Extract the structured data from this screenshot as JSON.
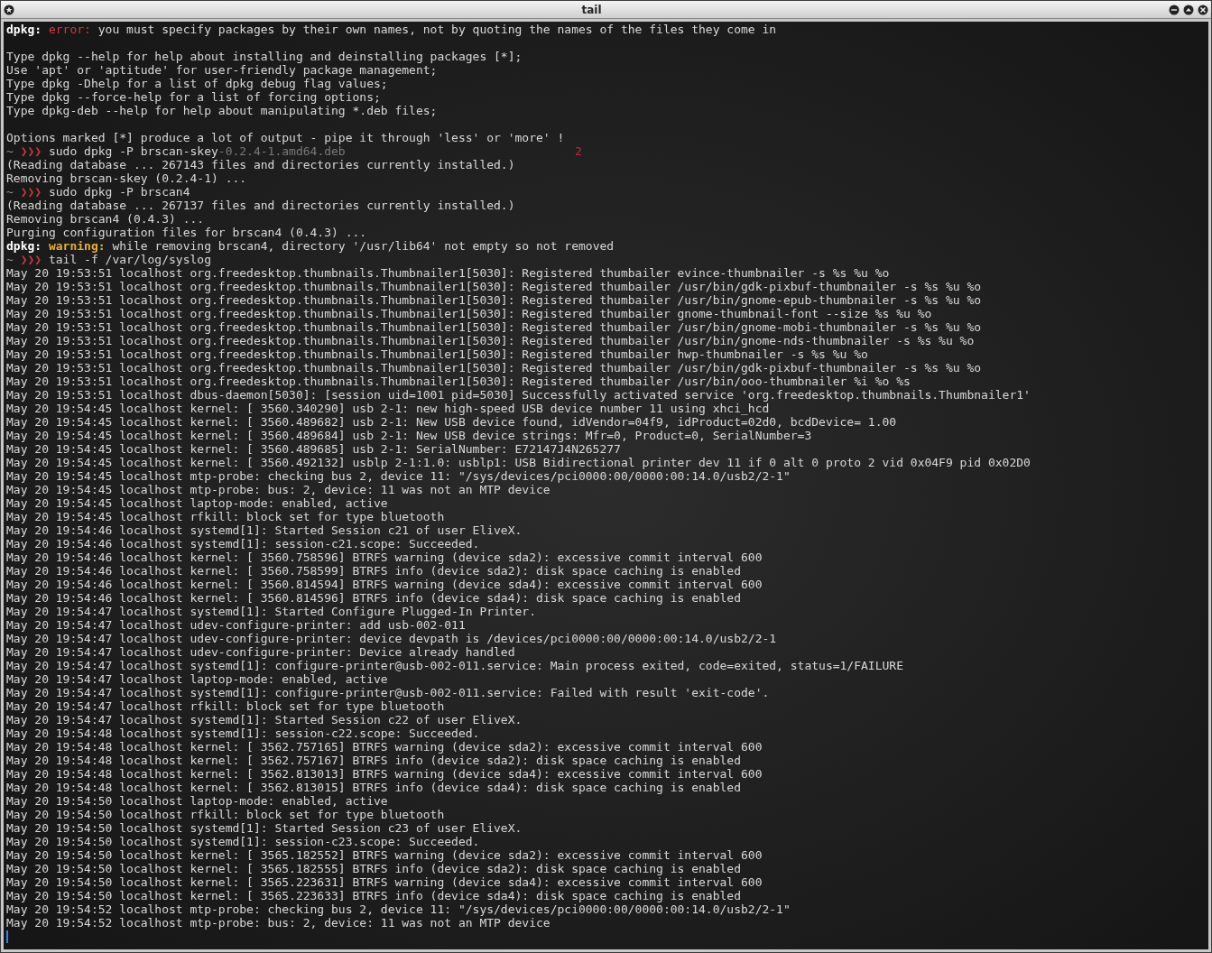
{
  "window": {
    "title": "tail"
  },
  "lines": [
    {
      "kind": "text",
      "segments": [
        {
          "kind": "bold",
          "text": "dpkg:"
        },
        {
          "kind": "error",
          "text": " error:"
        },
        {
          "kind": "plain",
          "text": " you must specify packages by their own names, not by quoting the names of the files they come in"
        }
      ]
    },
    {
      "kind": "blank"
    },
    {
      "kind": "text",
      "segments": [
        {
          "kind": "plain",
          "text": "Type dpkg --help for help about installing and deinstalling packages [*];"
        }
      ]
    },
    {
      "kind": "text",
      "segments": [
        {
          "kind": "plain",
          "text": "Use 'apt' or 'aptitude' for user-friendly package management;"
        }
      ]
    },
    {
      "kind": "text",
      "segments": [
        {
          "kind": "plain",
          "text": "Type dpkg -Dhelp for a list of dpkg debug flag values;"
        }
      ]
    },
    {
      "kind": "text",
      "segments": [
        {
          "kind": "plain",
          "text": "Type dpkg --force-help for a list of forcing options;"
        }
      ]
    },
    {
      "kind": "text",
      "segments": [
        {
          "kind": "plain",
          "text": "Type dpkg-deb --help for help about manipulating *.deb files;"
        }
      ]
    },
    {
      "kind": "blank"
    },
    {
      "kind": "text",
      "segments": [
        {
          "kind": "plain",
          "text": "Options marked [*] produce a lot of output - pipe it through 'less' or 'more' !"
        }
      ]
    },
    {
      "kind": "text",
      "segments": [
        {
          "kind": "tilde",
          "text": "~"
        },
        {
          "kind": "prompt",
          "text": "❯❯❯"
        },
        {
          "kind": "plain",
          "text": " sudo dpkg -P brscan-skey"
        },
        {
          "kind": "dim",
          "text": "-0.2.4-1.amd64.deb"
        },
        {
          "kind": "status",
          "text": "2"
        }
      ]
    },
    {
      "kind": "text",
      "segments": [
        {
          "kind": "plain",
          "text": "(Reading database ... 267143 files and directories currently installed.)"
        }
      ]
    },
    {
      "kind": "text",
      "segments": [
        {
          "kind": "plain",
          "text": "Removing brscan-skey (0.2.4-1) ..."
        }
      ]
    },
    {
      "kind": "text",
      "segments": [
        {
          "kind": "tilde",
          "text": "~"
        },
        {
          "kind": "prompt",
          "text": "❯❯❯"
        },
        {
          "kind": "plain",
          "text": " sudo dpkg -P brscan4"
        }
      ]
    },
    {
      "kind": "text",
      "segments": [
        {
          "kind": "plain",
          "text": "(Reading database ... 267137 files and directories currently installed.)"
        }
      ]
    },
    {
      "kind": "text",
      "segments": [
        {
          "kind": "plain",
          "text": "Removing brscan4 (0.4.3) ..."
        }
      ]
    },
    {
      "kind": "text",
      "segments": [
        {
          "kind": "plain",
          "text": "Purging configuration files for brscan4 (0.4.3) ..."
        }
      ]
    },
    {
      "kind": "text",
      "segments": [
        {
          "kind": "bold",
          "text": "dpkg:"
        },
        {
          "kind": "warning",
          "text": " warning:"
        },
        {
          "kind": "plain",
          "text": " while removing brscan4, directory '/usr/lib64' not empty so not removed"
        }
      ]
    },
    {
      "kind": "text",
      "segments": [
        {
          "kind": "tilde",
          "text": "~"
        },
        {
          "kind": "prompt",
          "text": "❯❯❯"
        },
        {
          "kind": "plain",
          "text": " tail -f /var/log/syslog"
        }
      ]
    },
    {
      "kind": "text",
      "segments": [
        {
          "kind": "plain",
          "text": "May 20 19:53:51 localhost org.freedesktop.thumbnails.Thumbnailer1[5030]: Registered thumbailer evince-thumbnailer -s %s %u %o"
        }
      ]
    },
    {
      "kind": "text",
      "segments": [
        {
          "kind": "plain",
          "text": "May 20 19:53:51 localhost org.freedesktop.thumbnails.Thumbnailer1[5030]: Registered thumbailer /usr/bin/gdk-pixbuf-thumbnailer -s %s %u %o"
        }
      ]
    },
    {
      "kind": "text",
      "segments": [
        {
          "kind": "plain",
          "text": "May 20 19:53:51 localhost org.freedesktop.thumbnails.Thumbnailer1[5030]: Registered thumbailer /usr/bin/gnome-epub-thumbnailer -s %s %u %o"
        }
      ]
    },
    {
      "kind": "text",
      "segments": [
        {
          "kind": "plain",
          "text": "May 20 19:53:51 localhost org.freedesktop.thumbnails.Thumbnailer1[5030]: Registered thumbailer gnome-thumbnail-font --size %s %u %o"
        }
      ]
    },
    {
      "kind": "text",
      "segments": [
        {
          "kind": "plain",
          "text": "May 20 19:53:51 localhost org.freedesktop.thumbnails.Thumbnailer1[5030]: Registered thumbailer /usr/bin/gnome-mobi-thumbnailer -s %s %u %o"
        }
      ]
    },
    {
      "kind": "text",
      "segments": [
        {
          "kind": "plain",
          "text": "May 20 19:53:51 localhost org.freedesktop.thumbnails.Thumbnailer1[5030]: Registered thumbailer /usr/bin/gnome-nds-thumbnailer -s %s %u %o"
        }
      ]
    },
    {
      "kind": "text",
      "segments": [
        {
          "kind": "plain",
          "text": "May 20 19:53:51 localhost org.freedesktop.thumbnails.Thumbnailer1[5030]: Registered thumbailer hwp-thumbnailer -s %s %u %o"
        }
      ]
    },
    {
      "kind": "text",
      "segments": [
        {
          "kind": "plain",
          "text": "May 20 19:53:51 localhost org.freedesktop.thumbnails.Thumbnailer1[5030]: Registered thumbailer /usr/bin/gdk-pixbuf-thumbnailer -s %s %u %o"
        }
      ]
    },
    {
      "kind": "text",
      "segments": [
        {
          "kind": "plain",
          "text": "May 20 19:53:51 localhost org.freedesktop.thumbnails.Thumbnailer1[5030]: Registered thumbailer /usr/bin/ooo-thumbnailer %i %o %s"
        }
      ]
    },
    {
      "kind": "text",
      "segments": [
        {
          "kind": "plain",
          "text": "May 20 19:53:51 localhost dbus-daemon[5030]: [session uid=1001 pid=5030] Successfully activated service 'org.freedesktop.thumbnails.Thumbnailer1'"
        }
      ]
    },
    {
      "kind": "text",
      "segments": [
        {
          "kind": "plain",
          "text": "May 20 19:54:45 localhost kernel: [ 3560.340290] usb 2-1: new high-speed USB device number 11 using xhci_hcd"
        }
      ]
    },
    {
      "kind": "text",
      "segments": [
        {
          "kind": "plain",
          "text": "May 20 19:54:45 localhost kernel: [ 3560.489682] usb 2-1: New USB device found, idVendor=04f9, idProduct=02d0, bcdDevice= 1.00"
        }
      ]
    },
    {
      "kind": "text",
      "segments": [
        {
          "kind": "plain",
          "text": "May 20 19:54:45 localhost kernel: [ 3560.489684] usb 2-1: New USB device strings: Mfr=0, Product=0, SerialNumber=3"
        }
      ]
    },
    {
      "kind": "text",
      "segments": [
        {
          "kind": "plain",
          "text": "May 20 19:54:45 localhost kernel: [ 3560.489685] usb 2-1: SerialNumber: E72147J4N265277"
        }
      ]
    },
    {
      "kind": "text",
      "segments": [
        {
          "kind": "plain",
          "text": "May 20 19:54:45 localhost kernel: [ 3560.492132] usblp 2-1:1.0: usblp1: USB Bidirectional printer dev 11 if 0 alt 0 proto 2 vid 0x04F9 pid 0x02D0"
        }
      ]
    },
    {
      "kind": "text",
      "segments": [
        {
          "kind": "plain",
          "text": "May 20 19:54:45 localhost mtp-probe: checking bus 2, device 11: \"/sys/devices/pci0000:00/0000:00:14.0/usb2/2-1\""
        }
      ]
    },
    {
      "kind": "text",
      "segments": [
        {
          "kind": "plain",
          "text": "May 20 19:54:45 localhost mtp-probe: bus: 2, device: 11 was not an MTP device"
        }
      ]
    },
    {
      "kind": "text",
      "segments": [
        {
          "kind": "plain",
          "text": "May 20 19:54:45 localhost laptop-mode: enabled, active"
        }
      ]
    },
    {
      "kind": "text",
      "segments": [
        {
          "kind": "plain",
          "text": "May 20 19:54:45 localhost rfkill: block set for type bluetooth"
        }
      ]
    },
    {
      "kind": "text",
      "segments": [
        {
          "kind": "plain",
          "text": "May 20 19:54:46 localhost systemd[1]: Started Session c21 of user EliveX."
        }
      ]
    },
    {
      "kind": "text",
      "segments": [
        {
          "kind": "plain",
          "text": "May 20 19:54:46 localhost systemd[1]: session-c21.scope: Succeeded."
        }
      ]
    },
    {
      "kind": "text",
      "segments": [
        {
          "kind": "plain",
          "text": "May 20 19:54:46 localhost kernel: [ 3560.758596] BTRFS warning (device sda2): excessive commit interval 600"
        }
      ]
    },
    {
      "kind": "text",
      "segments": [
        {
          "kind": "plain",
          "text": "May 20 19:54:46 localhost kernel: [ 3560.758599] BTRFS info (device sda2): disk space caching is enabled"
        }
      ]
    },
    {
      "kind": "text",
      "segments": [
        {
          "kind": "plain",
          "text": "May 20 19:54:46 localhost kernel: [ 3560.814594] BTRFS warning (device sda4): excessive commit interval 600"
        }
      ]
    },
    {
      "kind": "text",
      "segments": [
        {
          "kind": "plain",
          "text": "May 20 19:54:46 localhost kernel: [ 3560.814596] BTRFS info (device sda4): disk space caching is enabled"
        }
      ]
    },
    {
      "kind": "text",
      "segments": [
        {
          "kind": "plain",
          "text": "May 20 19:54:47 localhost systemd[1]: Started Configure Plugged-In Printer."
        }
      ]
    },
    {
      "kind": "text",
      "segments": [
        {
          "kind": "plain",
          "text": "May 20 19:54:47 localhost udev-configure-printer: add usb-002-011"
        }
      ]
    },
    {
      "kind": "text",
      "segments": [
        {
          "kind": "plain",
          "text": "May 20 19:54:47 localhost udev-configure-printer: device devpath is /devices/pci0000:00/0000:00:14.0/usb2/2-1"
        }
      ]
    },
    {
      "kind": "text",
      "segments": [
        {
          "kind": "plain",
          "text": "May 20 19:54:47 localhost udev-configure-printer: Device already handled"
        }
      ]
    },
    {
      "kind": "text",
      "segments": [
        {
          "kind": "plain",
          "text": "May 20 19:54:47 localhost systemd[1]: configure-printer@usb-002-011.service: Main process exited, code=exited, status=1/FAILURE"
        }
      ]
    },
    {
      "kind": "text",
      "segments": [
        {
          "kind": "plain",
          "text": "May 20 19:54:47 localhost laptop-mode: enabled, active"
        }
      ]
    },
    {
      "kind": "text",
      "segments": [
        {
          "kind": "plain",
          "text": "May 20 19:54:47 localhost systemd[1]: configure-printer@usb-002-011.service: Failed with result 'exit-code'."
        }
      ]
    },
    {
      "kind": "text",
      "segments": [
        {
          "kind": "plain",
          "text": "May 20 19:54:47 localhost rfkill: block set for type bluetooth"
        }
      ]
    },
    {
      "kind": "text",
      "segments": [
        {
          "kind": "plain",
          "text": "May 20 19:54:47 localhost systemd[1]: Started Session c22 of user EliveX."
        }
      ]
    },
    {
      "kind": "text",
      "segments": [
        {
          "kind": "plain",
          "text": "May 20 19:54:48 localhost systemd[1]: session-c22.scope: Succeeded."
        }
      ]
    },
    {
      "kind": "text",
      "segments": [
        {
          "kind": "plain",
          "text": "May 20 19:54:48 localhost kernel: [ 3562.757165] BTRFS warning (device sda2): excessive commit interval 600"
        }
      ]
    },
    {
      "kind": "text",
      "segments": [
        {
          "kind": "plain",
          "text": "May 20 19:54:48 localhost kernel: [ 3562.757167] BTRFS info (device sda2): disk space caching is enabled"
        }
      ]
    },
    {
      "kind": "text",
      "segments": [
        {
          "kind": "plain",
          "text": "May 20 19:54:48 localhost kernel: [ 3562.813013] BTRFS warning (device sda4): excessive commit interval 600"
        }
      ]
    },
    {
      "kind": "text",
      "segments": [
        {
          "kind": "plain",
          "text": "May 20 19:54:48 localhost kernel: [ 3562.813015] BTRFS info (device sda4): disk space caching is enabled"
        }
      ]
    },
    {
      "kind": "text",
      "segments": [
        {
          "kind": "plain",
          "text": "May 20 19:54:50 localhost laptop-mode: enabled, active"
        }
      ]
    },
    {
      "kind": "text",
      "segments": [
        {
          "kind": "plain",
          "text": "May 20 19:54:50 localhost rfkill: block set for type bluetooth"
        }
      ]
    },
    {
      "kind": "text",
      "segments": [
        {
          "kind": "plain",
          "text": "May 20 19:54:50 localhost systemd[1]: Started Session c23 of user EliveX."
        }
      ]
    },
    {
      "kind": "text",
      "segments": [
        {
          "kind": "plain",
          "text": "May 20 19:54:50 localhost systemd[1]: session-c23.scope: Succeeded."
        }
      ]
    },
    {
      "kind": "text",
      "segments": [
        {
          "kind": "plain",
          "text": "May 20 19:54:50 localhost kernel: [ 3565.182552] BTRFS warning (device sda2): excessive commit interval 600"
        }
      ]
    },
    {
      "kind": "text",
      "segments": [
        {
          "kind": "plain",
          "text": "May 20 19:54:50 localhost kernel: [ 3565.182555] BTRFS info (device sda2): disk space caching is enabled"
        }
      ]
    },
    {
      "kind": "text",
      "segments": [
        {
          "kind": "plain",
          "text": "May 20 19:54:50 localhost kernel: [ 3565.223631] BTRFS warning (device sda4): excessive commit interval 600"
        }
      ]
    },
    {
      "kind": "text",
      "segments": [
        {
          "kind": "plain",
          "text": "May 20 19:54:50 localhost kernel: [ 3565.223633] BTRFS info (device sda4): disk space caching is enabled"
        }
      ]
    },
    {
      "kind": "text",
      "segments": [
        {
          "kind": "plain",
          "text": "May 20 19:54:52 localhost mtp-probe: checking bus 2, device 11: \"/sys/devices/pci0000:00/0000:00:14.0/usb2/2-1\""
        }
      ]
    },
    {
      "kind": "text",
      "segments": [
        {
          "kind": "plain",
          "text": "May 20 19:54:52 localhost mtp-probe: bus: 2, device: 11 was not an MTP device"
        }
      ]
    }
  ]
}
